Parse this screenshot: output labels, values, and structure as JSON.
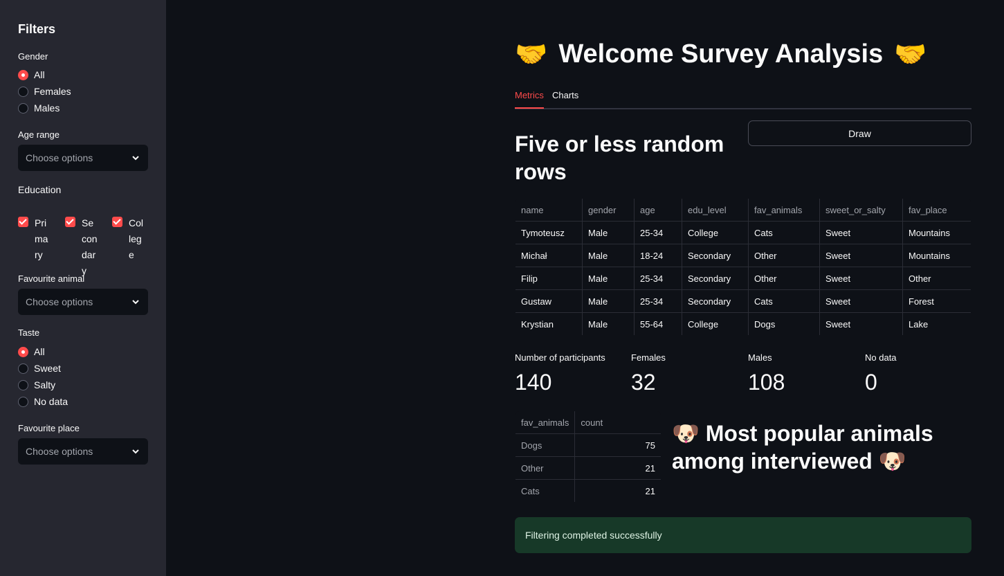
{
  "sidebar": {
    "title": "Filters",
    "gender": {
      "label": "Gender",
      "options": [
        "All",
        "Females",
        "Males"
      ],
      "selected": "All"
    },
    "age_range": {
      "label": "Age range",
      "placeholder": "Choose options"
    },
    "education": {
      "label": "Education",
      "options": [
        "Primary",
        "Secondary",
        "College"
      ],
      "checked": [
        true,
        true,
        true
      ]
    },
    "animal": {
      "label": "Favourite animal",
      "placeholder": "Choose options"
    },
    "taste": {
      "label": "Taste",
      "options": [
        "All",
        "Sweet",
        "Salty",
        "No data"
      ],
      "selected": "All"
    },
    "place": {
      "label": "Favourite place",
      "placeholder": "Choose options"
    }
  },
  "main": {
    "title": "Welcome Survey Analysis",
    "title_emoji": "🤝",
    "tabs": [
      {
        "label": "Metrics",
        "active": true
      },
      {
        "label": "Charts",
        "active": false
      }
    ],
    "random_rows_title": "Five or less random rows",
    "draw_label": "Draw",
    "rows_table": {
      "columns": [
        "name",
        "gender",
        "age",
        "edu_level",
        "fav_animals",
        "sweet_or_salty",
        "fav_place"
      ],
      "rows": [
        [
          "Tymoteusz",
          "Male",
          "25-34",
          "College",
          "Cats",
          "Sweet",
          "Mountains"
        ],
        [
          "Michał",
          "Male",
          "18-24",
          "Secondary",
          "Other",
          "Sweet",
          "Mountains"
        ],
        [
          "Filip",
          "Male",
          "25-34",
          "Secondary",
          "Other",
          "Sweet",
          "Other"
        ],
        [
          "Gustaw",
          "Male",
          "25-34",
          "Secondary",
          "Cats",
          "Sweet",
          "Forest"
        ],
        [
          "Krystian",
          "Male",
          "55-64",
          "College",
          "Dogs",
          "Sweet",
          "Lake"
        ]
      ]
    },
    "metrics": [
      {
        "label": "Number of participants",
        "value": "140"
      },
      {
        "label": "Females",
        "value": "32"
      },
      {
        "label": "Males",
        "value": "108"
      },
      {
        "label": "No data",
        "value": "0"
      }
    ],
    "animals_table": {
      "columns": [
        "fav_animals",
        "count"
      ],
      "rows": [
        [
          "Dogs",
          "75"
        ],
        [
          "Other",
          "21"
        ],
        [
          "Cats",
          "21"
        ]
      ]
    },
    "animals_title": "Most popular animals among interviewed",
    "animals_emoji": "🐶",
    "alert": "Filtering completed successfully"
  },
  "colors": {
    "accent": "#ff4b4b",
    "background": "#0e1117",
    "sidebar": "#262730",
    "success_bg": "#173928"
  }
}
